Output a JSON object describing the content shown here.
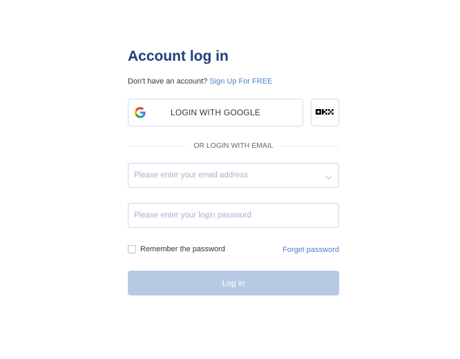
{
  "login": {
    "title": "Account log in",
    "signup_prompt": "Don't have an account?",
    "signup_link": "Sign Up For FREE",
    "google_button_label": "LOGIN WITH GOOGLE",
    "google_icon": "google-icon",
    "okx_icon": "okx-logo-icon",
    "divider_text": "OR LOGIN WITH EMAIL",
    "email_placeholder": "Please enter your email address",
    "email_value": "",
    "password_placeholder": "Please enter your login password",
    "password_value": "",
    "remember_label": "Remember the password",
    "remember_checked": false,
    "forgot_label": "Forget password",
    "login_button_label": "Log in"
  },
  "colors": {
    "title": "#1f3f7a",
    "link": "#4d7fc7",
    "login_button_disabled": "#b7cae4",
    "border": "#d4dae6"
  }
}
